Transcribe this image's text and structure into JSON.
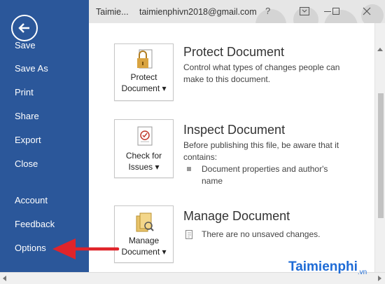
{
  "sidebar": {
    "items": [
      {
        "label": "Save"
      },
      {
        "label": "Save As"
      },
      {
        "label": "Print"
      },
      {
        "label": "Share"
      },
      {
        "label": "Export"
      },
      {
        "label": "Close"
      },
      {
        "label": "Account"
      },
      {
        "label": "Feedback"
      },
      {
        "label": "Options"
      }
    ]
  },
  "titlebar": {
    "title": "Taimie...",
    "account": "taimienphivn2018@gmail.com",
    "help": "?"
  },
  "sections": [
    {
      "button_label_line1": "Protect",
      "button_label_line2": "Document ▾",
      "title": "Protect Document",
      "description": "Control what types of changes people can make to this document."
    },
    {
      "button_label_line1": "Check for",
      "button_label_line2": "Issues ▾",
      "title": "Inspect Document",
      "description": "Before publishing this file, be aware that it contains:",
      "bullet": "Document properties and author's name"
    },
    {
      "button_label_line1": "Manage",
      "button_label_line2": "Document ▾",
      "title": "Manage Document",
      "status": "There are no unsaved changes."
    }
  ],
  "watermark": {
    "text": "Taimienphi",
    "suffix": ".vn"
  },
  "colors": {
    "sidebar": "#2b579a",
    "annotation_arrow": "#e0242a"
  }
}
